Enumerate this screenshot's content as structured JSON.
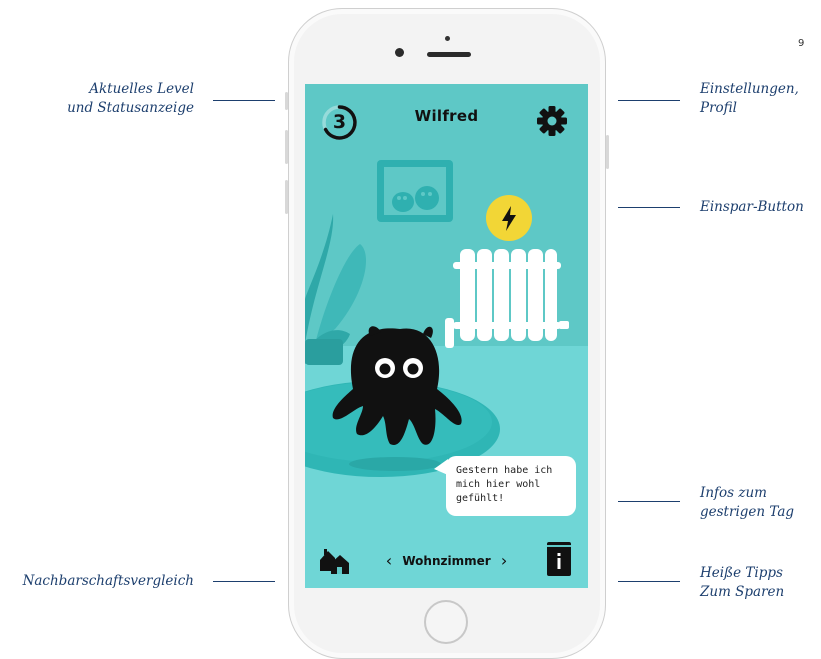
{
  "page_number": "9",
  "annotations": {
    "level_status": [
      "Aktuelles Level",
      "und Statusanzeige"
    ],
    "settings_profile": [
      "Einstellungen,",
      "Profil"
    ],
    "save_button": [
      "Einspar-Button"
    ],
    "yesterday_info": [
      "Infos zum",
      "gestrigen Tag"
    ],
    "neighborhood": [
      "Nachbarschaftsvergleich"
    ],
    "hot_tips": [
      "Heiße Tipps",
      "Zum Sparen"
    ]
  },
  "app": {
    "title": "Wilfred",
    "level": "3",
    "room": "Wohnzimmer",
    "prev_room_icon": "chevron-left-icon",
    "next_room_icon": "chevron-right-icon",
    "speech_bubble": "Gestern habe ich mich hier wohl gefühlt!",
    "icons": [
      "gear-icon",
      "lightning-icon",
      "houses-icon",
      "info-book-icon"
    ],
    "colors": {
      "screen_bg": "#5ec8c6",
      "floor": "#6fd6d6",
      "rug": "#2fb6b5",
      "monster": "#111111",
      "save_button": "#f2d636",
      "annotation_text": "#1d3f6e"
    }
  }
}
